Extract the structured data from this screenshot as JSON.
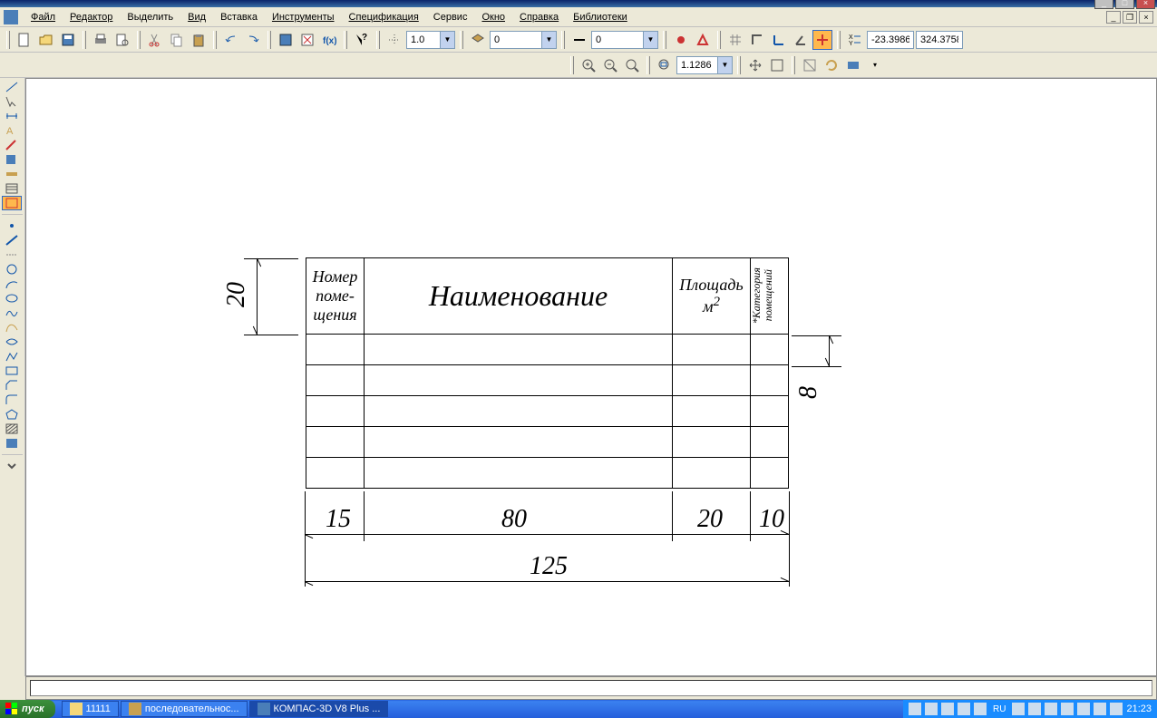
{
  "menu": {
    "file": "Файл",
    "edit": "Редактор",
    "select": "Выделить",
    "view": "Вид",
    "insert": "Вставка",
    "tools": "Инструменты",
    "spec": "Спецификация",
    "service": "Сервис",
    "window": "Окно",
    "help": "Справка",
    "libraries": "Библиотеки"
  },
  "toolbar": {
    "step": "1.0",
    "layer": "0",
    "style": "0",
    "coord_x": "-23.3986",
    "coord_y": "324.3758",
    "zoom": "1.1286"
  },
  "drawing": {
    "header": {
      "col1_l1": "Номер",
      "col1_l2": "поме-",
      "col1_l3": "щения",
      "col2": "Наименование",
      "col3_l1": "Площадь",
      "col3_l2": "м",
      "col3_sup": "2",
      "col4_l1": "*Категория",
      "col4_l2": "помещений"
    },
    "dims": {
      "left_v": "20",
      "right_v": "8",
      "c1": "15",
      "c2": "80",
      "c3": "20",
      "c4": "10",
      "total": "125"
    }
  },
  "taskbar": {
    "start": "пуск",
    "task1": "11111",
    "task2": "последовательнос...",
    "task3": "КОМПАС-3D V8 Plus ...",
    "lang": "RU",
    "time": "21:23"
  }
}
